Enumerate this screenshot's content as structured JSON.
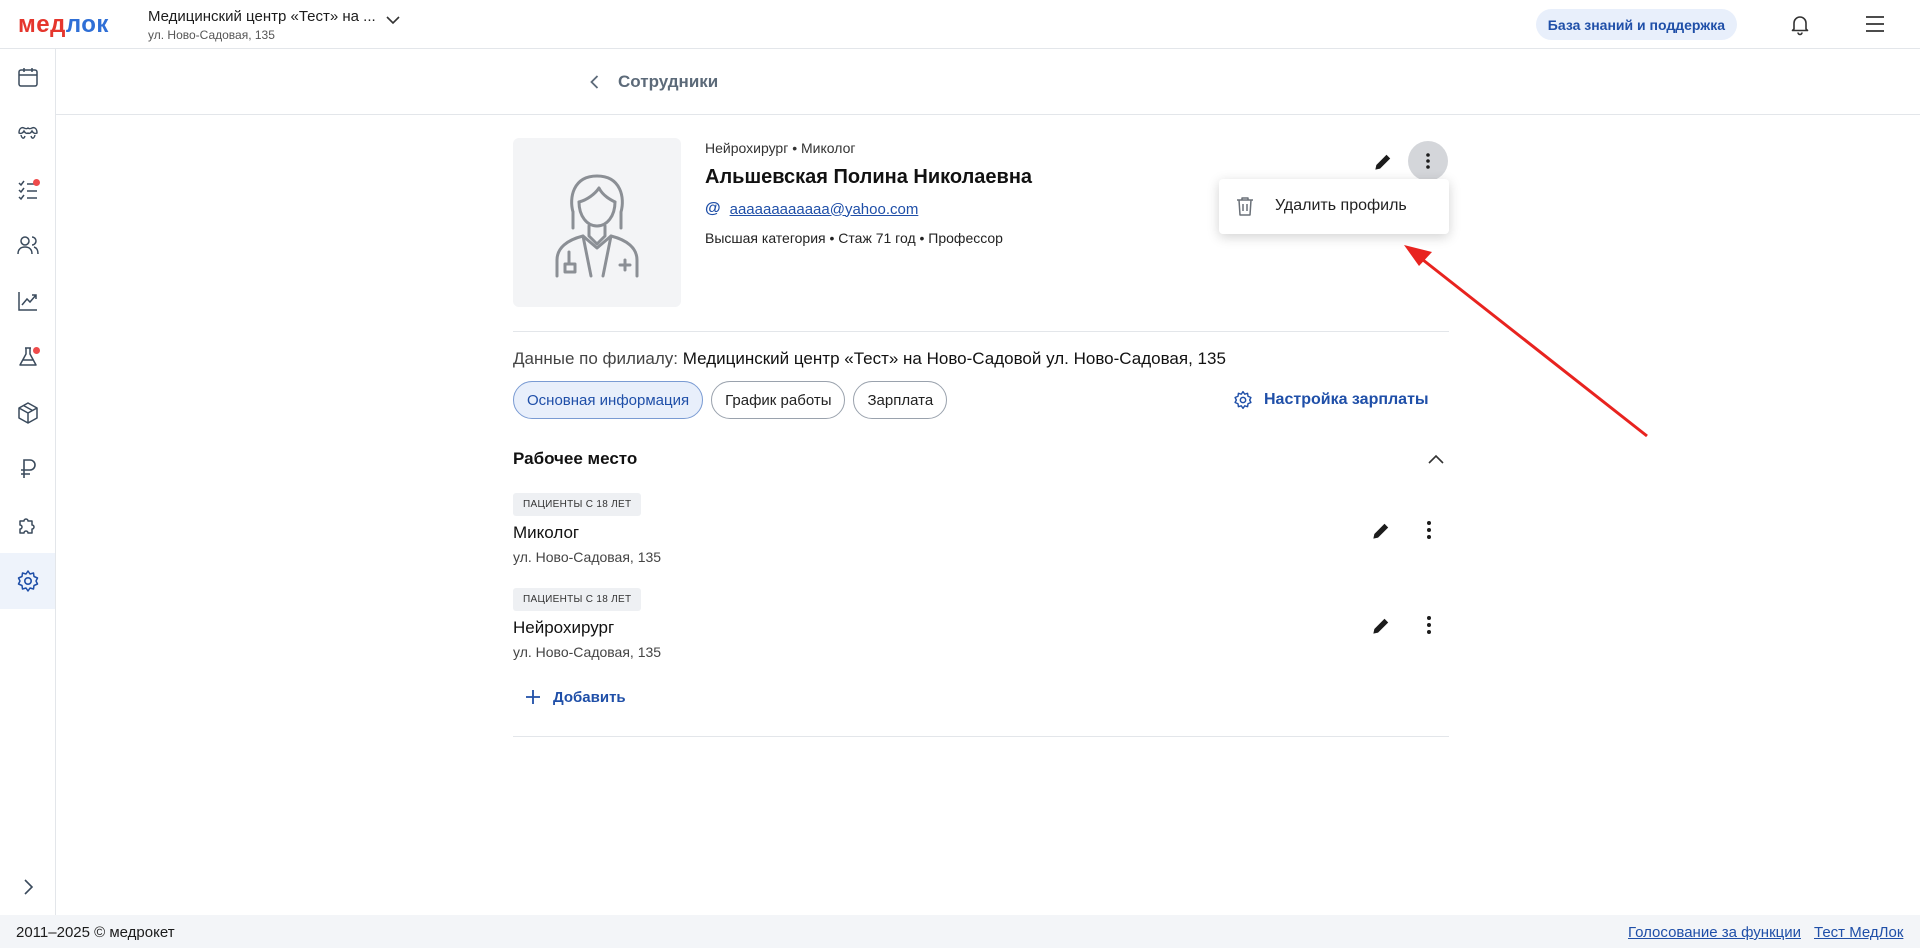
{
  "header": {
    "logo": "медлок",
    "clinic_name": "Медицинский центр «Тест» на ...",
    "clinic_address": "ул. Ново-Садовая, 135",
    "kb_button": "База знаний и поддержка"
  },
  "sidebar": {
    "items": [
      {
        "icon": "calendar-icon"
      },
      {
        "icon": "tooth-icon"
      },
      {
        "icon": "tasks-icon",
        "badge": true
      },
      {
        "icon": "users-icon"
      },
      {
        "icon": "chart-icon"
      },
      {
        "icon": "flask-icon",
        "badge": true
      },
      {
        "icon": "box-icon"
      },
      {
        "icon": "ruble-icon"
      },
      {
        "icon": "puzzle-icon"
      },
      {
        "icon": "gear-icon",
        "active": true
      }
    ]
  },
  "breadcrumb": {
    "back_label": "Сотрудники"
  },
  "profile": {
    "specialties": "Нейрохирург • Миколог",
    "full_name": "Альшевская Полина Николаевна",
    "email": "aaaaaaaaaaaa@yahoo.com",
    "meta": "Высшая категория • Стаж 71 год • Профессор"
  },
  "context_menu": {
    "delete_label": "Удалить профиль"
  },
  "branch": {
    "label": "Данные по филиалу:",
    "value": "Медицинский центр «Тест» на Ново-Садовой ул. Ново-Садовая, 135"
  },
  "tabs": [
    {
      "label": "Основная информация",
      "active": true
    },
    {
      "label": "График работы",
      "active": false
    },
    {
      "label": "Зарплата",
      "active": false
    }
  ],
  "salary_settings_label": "Настройка зарплаты",
  "workplace": {
    "title": "Рабочее место",
    "items": [
      {
        "badge": "ПАЦИЕНТЫ С 18 ЛЕТ",
        "name": "Миколог",
        "address": "ул. Ново-Садовая, 135"
      },
      {
        "badge": "ПАЦИЕНТЫ С 18 ЛЕТ",
        "name": "Нейрохирург",
        "address": "ул. Ново-Садовая, 135"
      }
    ],
    "add_label": "Добавить"
  },
  "footer": {
    "copyright": "2011–2025 © медрокет",
    "vote_link": "Голосование за функции",
    "test_link": "Тест МедЛок"
  },
  "colors": {
    "accent": "#1f4fa8",
    "logo_red": "#e5362d",
    "arrow": "#e8231f",
    "badge_dot": "#ef4b4b"
  }
}
